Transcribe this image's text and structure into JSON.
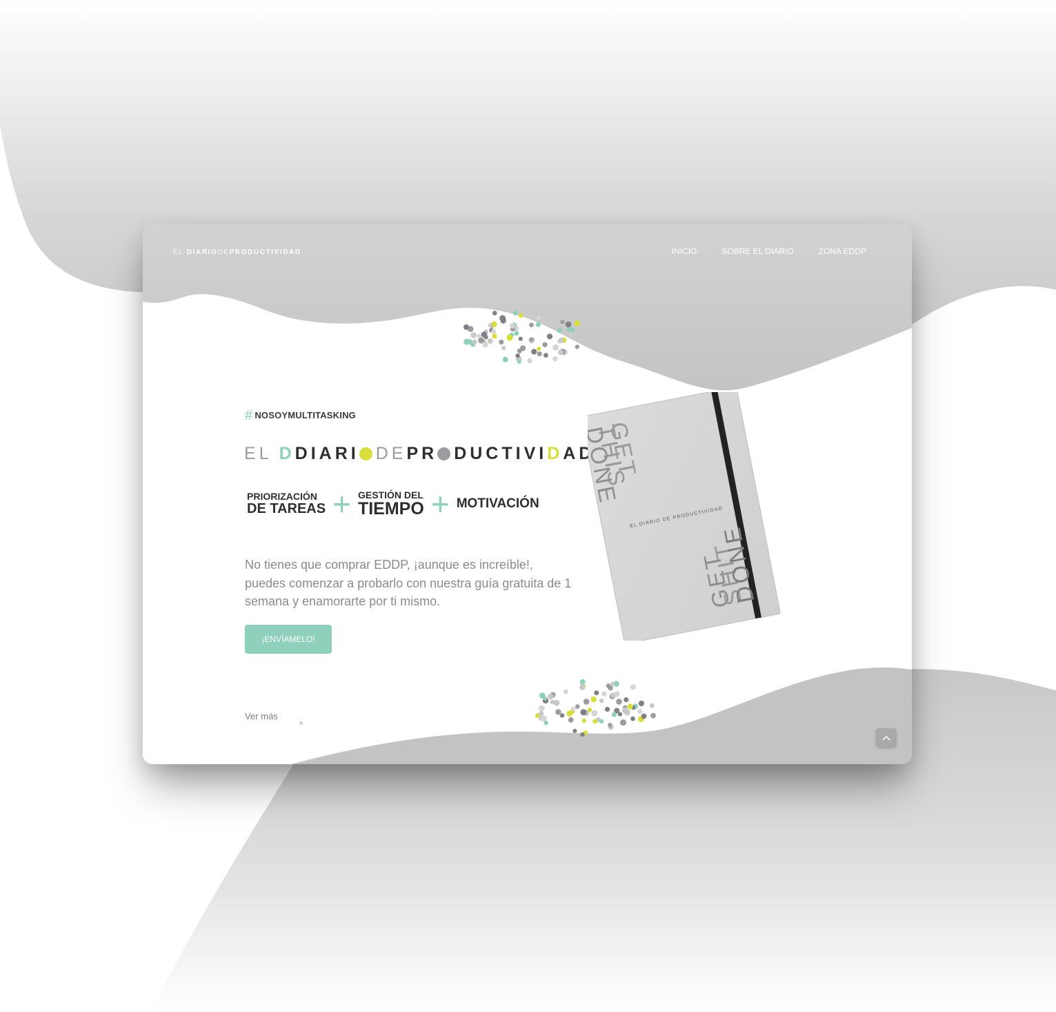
{
  "window": {
    "brand_logo": {
      "part1": "EL",
      "part2": "DIARIO",
      "part3": "DE",
      "part4": "PRODUCTIVIDAD"
    },
    "nav": [
      {
        "label": "INICIO"
      },
      {
        "label": "SOBRE EL DIARIO"
      },
      {
        "label": "ZONA EDDP"
      }
    ]
  },
  "hero": {
    "hashtag_symbol": "#",
    "hashtag": "NOSOYMULTITASKING",
    "logo": {
      "el": "EL",
      "diari": "DIARI",
      "de": "DE",
      "pr": "PR",
      "ductivi": "DUCTIVI",
      "ad": "AD",
      "d_teal": "D",
      "d_yellow": "D"
    },
    "formula": {
      "item1_line1": "PRIORIZACIÓN",
      "item1_line2": "DE TAREAS",
      "plus": "+",
      "item2_line1": "GESTIÓN DEL",
      "item2_line2": "TIEMPO",
      "item3": "MOTIVACIÓN"
    },
    "lead": "No tienes que comprar EDDP, ¡aunque es increíble!, puedes comenzar a probarlo con nuestra guía gratuita de 1 semana y enamorarte por ti mismo.",
    "cta_label": "¡ENVÍAMELO!",
    "ver_mas": "Ver más",
    "ver_mas_icon": "double-chevron-down-icon",
    "scroll_top_icon": "chevron-up-icon"
  },
  "notebook": {
    "top_text": [
      "GET",
      "THIS",
      "DONE"
    ],
    "bottom_text": [
      "GET",
      "SHIT",
      "DONE"
    ],
    "band_text": "EL DIARIO DE PRODUCTIVIDAD"
  },
  "colors": {
    "accent_teal": "#8fd0bc",
    "accent_yellow": "#d8de39",
    "text_dark": "#2e2e2e",
    "text_muted": "#8a8a92",
    "wave_gray": "#c9c9ca"
  }
}
